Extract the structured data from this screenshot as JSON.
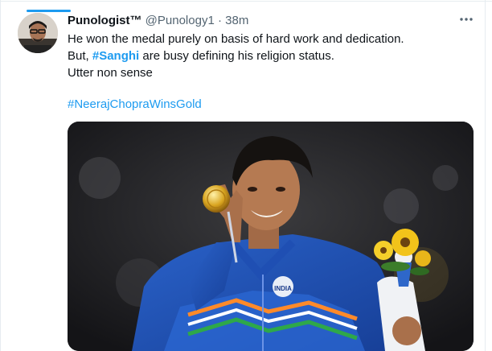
{
  "tweet": {
    "display_name": "Punologist™",
    "handle": "@Punology1",
    "separator": "·",
    "time": "38m",
    "line1": "He won the medal purely on basis of hard work and dedication.",
    "line2_prefix": "But, ",
    "line2_hashtag": "#Sanghi",
    "line2_suffix": " are busy defining his religion status.",
    "line3": "Utter non sense",
    "hashtag_line": "#NeerajChopraWinsGold"
  },
  "media": {
    "jacket_text_line1": "INDIA",
    "alt": "Athlete in blue jacket holding a gold medal and a bouquet"
  },
  "icons": {
    "more": "more-horizontal-icon"
  },
  "colors": {
    "accent": "#1d9bf0",
    "secondary_text": "#536471",
    "primary_text": "#0f1419"
  }
}
